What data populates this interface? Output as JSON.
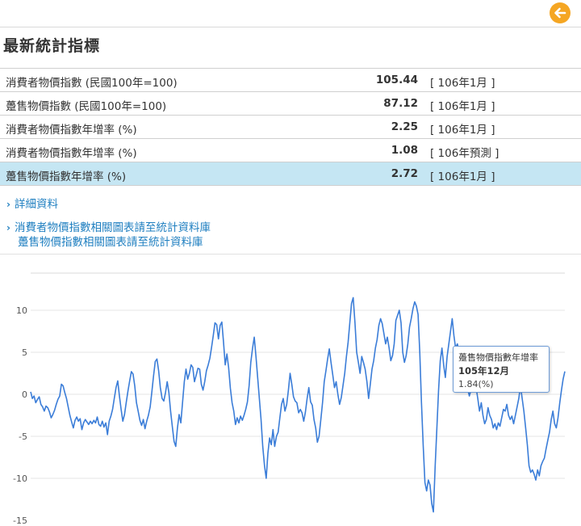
{
  "header": {
    "title": "最新統計指標",
    "back_icon": "arrow-left-icon",
    "accent": "#f5a623"
  },
  "indicators": [
    {
      "label": "消費者物價指數 (民國100年=100)",
      "value": "105.44",
      "period": "[ 106年1月 ]",
      "highlight": false
    },
    {
      "label": "躉售物價指數 (民國100年=100)",
      "value": "87.12",
      "period": "[ 106年1月 ]",
      "highlight": false
    },
    {
      "label": "消費者物價指數年增率 (%)",
      "value": "2.25",
      "period": "[ 106年1月 ]",
      "highlight": false
    },
    {
      "label": "消費者物價指數年增率 (%)",
      "value": "1.08",
      "period": "[ 106年預測 ]",
      "highlight": false
    },
    {
      "label": "躉售物價指數年增率 (%)",
      "value": "2.72",
      "period": "[ 106年1月 ]",
      "highlight": true
    }
  ],
  "links": {
    "detail": "詳細資料",
    "cpi_charts": "消費者物價指數相關圖表請至統計資料庫",
    "wpi_charts": "躉售物價指數相關圖表請至統計資料庫"
  },
  "tooltip": {
    "series": "躉售物價指數年增率",
    "date": "105年12月",
    "value": "1.84(%)"
  },
  "chart_data": {
    "type": "line",
    "series": [
      {
        "name": "躉售物價指數年增率",
        "color": "#3b7dd8",
        "values": [
          0.3,
          -0.5,
          -0.2,
          -1.0,
          -0.6,
          -0.3,
          -1.2,
          -1.5,
          -2.0,
          -1.4,
          -1.6,
          -2.1,
          -2.8,
          -2.4,
          -1.9,
          -1.2,
          -0.6,
          -0.2,
          1.2,
          1.0,
          0.2,
          -0.5,
          -1.5,
          -2.5,
          -3.3,
          -4.0,
          -3.1,
          -2.7,
          -3.2,
          -2.9,
          -4.2,
          -3.4,
          -3.0,
          -3.3,
          -3.6,
          -3.2,
          -3.5,
          -3.1,
          -3.4,
          -2.7,
          -3.6,
          -3.8,
          -3.2,
          -3.9,
          -3.4,
          -4.8,
          -3.2,
          -2.6,
          -1.8,
          -0.5,
          0.8,
          1.6,
          -0.2,
          -1.8,
          -3.2,
          -2.4,
          -1.0,
          0.4,
          1.6,
          2.7,
          2.4,
          1.0,
          -1.0,
          -2.0,
          -3.1,
          -3.7,
          -3.0,
          -4.1,
          -3.2,
          -2.5,
          -1.5,
          0.3,
          2.2,
          3.9,
          4.2,
          2.8,
          0.8,
          -0.5,
          -0.8,
          0.2,
          1.5,
          0.2,
          -2.0,
          -3.8,
          -5.6,
          -6.2,
          -4.0,
          -2.4,
          -3.4,
          -1.0,
          1.5,
          3.0,
          1.8,
          2.5,
          3.5,
          3.2,
          1.5,
          2.3,
          3.1,
          3.0,
          1.2,
          0.5,
          1.5,
          2.8,
          3.5,
          4.3,
          5.6,
          7.0,
          8.5,
          8.3,
          6.6,
          8.2,
          8.6,
          6.2,
          3.5,
          4.8,
          3.2,
          0.7,
          -1.0,
          -2.0,
          -3.6,
          -2.8,
          -3.4,
          -2.6,
          -3.1,
          -2.5,
          -1.8,
          -0.9,
          1.0,
          3.8,
          5.5,
          6.8,
          4.5,
          2.0,
          -0.5,
          -3.0,
          -6.2,
          -8.5,
          -10.0,
          -7.0,
          -5.2,
          -6.0,
          -4.2,
          -6.2,
          -5.0,
          -4.5,
          -2.8,
          -1.2,
          -0.5,
          -2.0,
          -1.2,
          0.5,
          2.5,
          1.2,
          -0.3,
          -0.8,
          -1.0,
          -2.2,
          -1.8,
          -2.2,
          -3.2,
          -2.1,
          -0.5,
          0.8,
          -0.9,
          -1.3,
          -3.0,
          -4.0,
          -5.7,
          -5.0,
          -3.0,
          -1.0,
          1.5,
          2.8,
          4.2,
          5.4,
          3.8,
          2.3,
          0.8,
          1.5,
          0.0,
          -1.2,
          -0.4,
          1.0,
          2.5,
          4.5,
          6.2,
          8.5,
          10.8,
          11.5,
          8.5,
          5.0,
          3.8,
          2.5,
          4.5,
          3.8,
          3.0,
          1.5,
          -0.5,
          1.2,
          3.0,
          4.0,
          5.5,
          6.5,
          8.2,
          9.0,
          8.4,
          7.2,
          6.0,
          6.8,
          5.5,
          4.0,
          4.6,
          6.0,
          8.8,
          9.4,
          10.0,
          8.5,
          5.0,
          3.8,
          4.6,
          6.0,
          8.0,
          9.0,
          10.2,
          11.0,
          10.5,
          9.5,
          5.0,
          -1.0,
          -6.2,
          -10.5,
          -11.5,
          -10.2,
          -10.8,
          -13.0,
          -14.0,
          -8.5,
          -4.0,
          0.5,
          4.0,
          5.5,
          3.5,
          2.0,
          4.5,
          6.0,
          7.5,
          9.0,
          7.0,
          5.5,
          6.0,
          5.0,
          4.8,
          3.5,
          2.5,
          1.8,
          0.7,
          -0.2,
          0.5,
          2.0,
          1.5,
          0.8,
          -0.5,
          -2.0,
          -1.0,
          -2.5,
          -3.5,
          -3.0,
          -1.6,
          -2.5,
          -3.0,
          -4.0,
          -3.5,
          -4.2,
          -3.4,
          -3.8,
          -2.8,
          -1.8,
          -2.0,
          -1.2,
          -2.5,
          -3.0,
          -2.6,
          -3.5,
          -2.5,
          -1.5,
          -0.5,
          1.0,
          -0.5,
          -2.0,
          -4.0,
          -6.0,
          -8.5,
          -9.3,
          -9.0,
          -9.5,
          -10.2,
          -9.0,
          -9.7,
          -8.5,
          -8.0,
          -7.6,
          -6.5,
          -5.5,
          -4.5,
          -3.0,
          -2.0,
          -3.5,
          -4.0,
          -2.8,
          -1.0,
          0.5,
          1.84,
          2.72
        ]
      }
    ],
    "ylim": [
      -15,
      12
    ],
    "yticks": [
      10,
      5,
      0,
      -5,
      -10,
      -15
    ],
    "grid": true,
    "legend": "none"
  }
}
